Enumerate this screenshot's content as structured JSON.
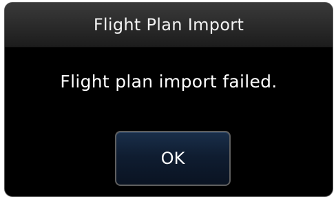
{
  "dialog": {
    "title": "Flight Plan Import",
    "message": "Flight plan import failed.",
    "ok_label": "OK"
  },
  "colors": {
    "background": "#000000",
    "text": "#ffffff",
    "button": "#0f1d31",
    "border": "#5f5f5f"
  }
}
